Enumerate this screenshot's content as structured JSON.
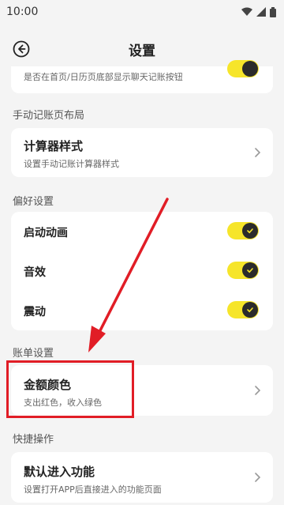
{
  "status_bar": {
    "time": "10:00"
  },
  "header": {
    "title": "设置"
  },
  "top_partial": {
    "subtitle": "是否在首页/日历页底部显示聊天记账按钮",
    "toggle_on": true
  },
  "sections": {
    "manual": {
      "title": "手动记账页布局",
      "item": {
        "title": "计算器样式",
        "subtitle": "设置手动记账计算器样式"
      }
    },
    "prefs": {
      "title": "偏好设置",
      "items": [
        {
          "label": "启动动画",
          "on": true
        },
        {
          "label": "音效",
          "on": true
        },
        {
          "label": "震动",
          "on": true
        }
      ]
    },
    "bill": {
      "title": "账单设置",
      "item": {
        "title": "金额颜色",
        "subtitle": "支出红色，收入绿色"
      }
    },
    "shortcut": {
      "title": "快捷操作",
      "item": {
        "title": "默认进入功能",
        "subtitle": "设置打开APP后直接进入的功能页面"
      }
    }
  },
  "colors": {
    "accent": "#f6e52a",
    "annotation": "#e11d26",
    "background": "#f4f4f4"
  }
}
